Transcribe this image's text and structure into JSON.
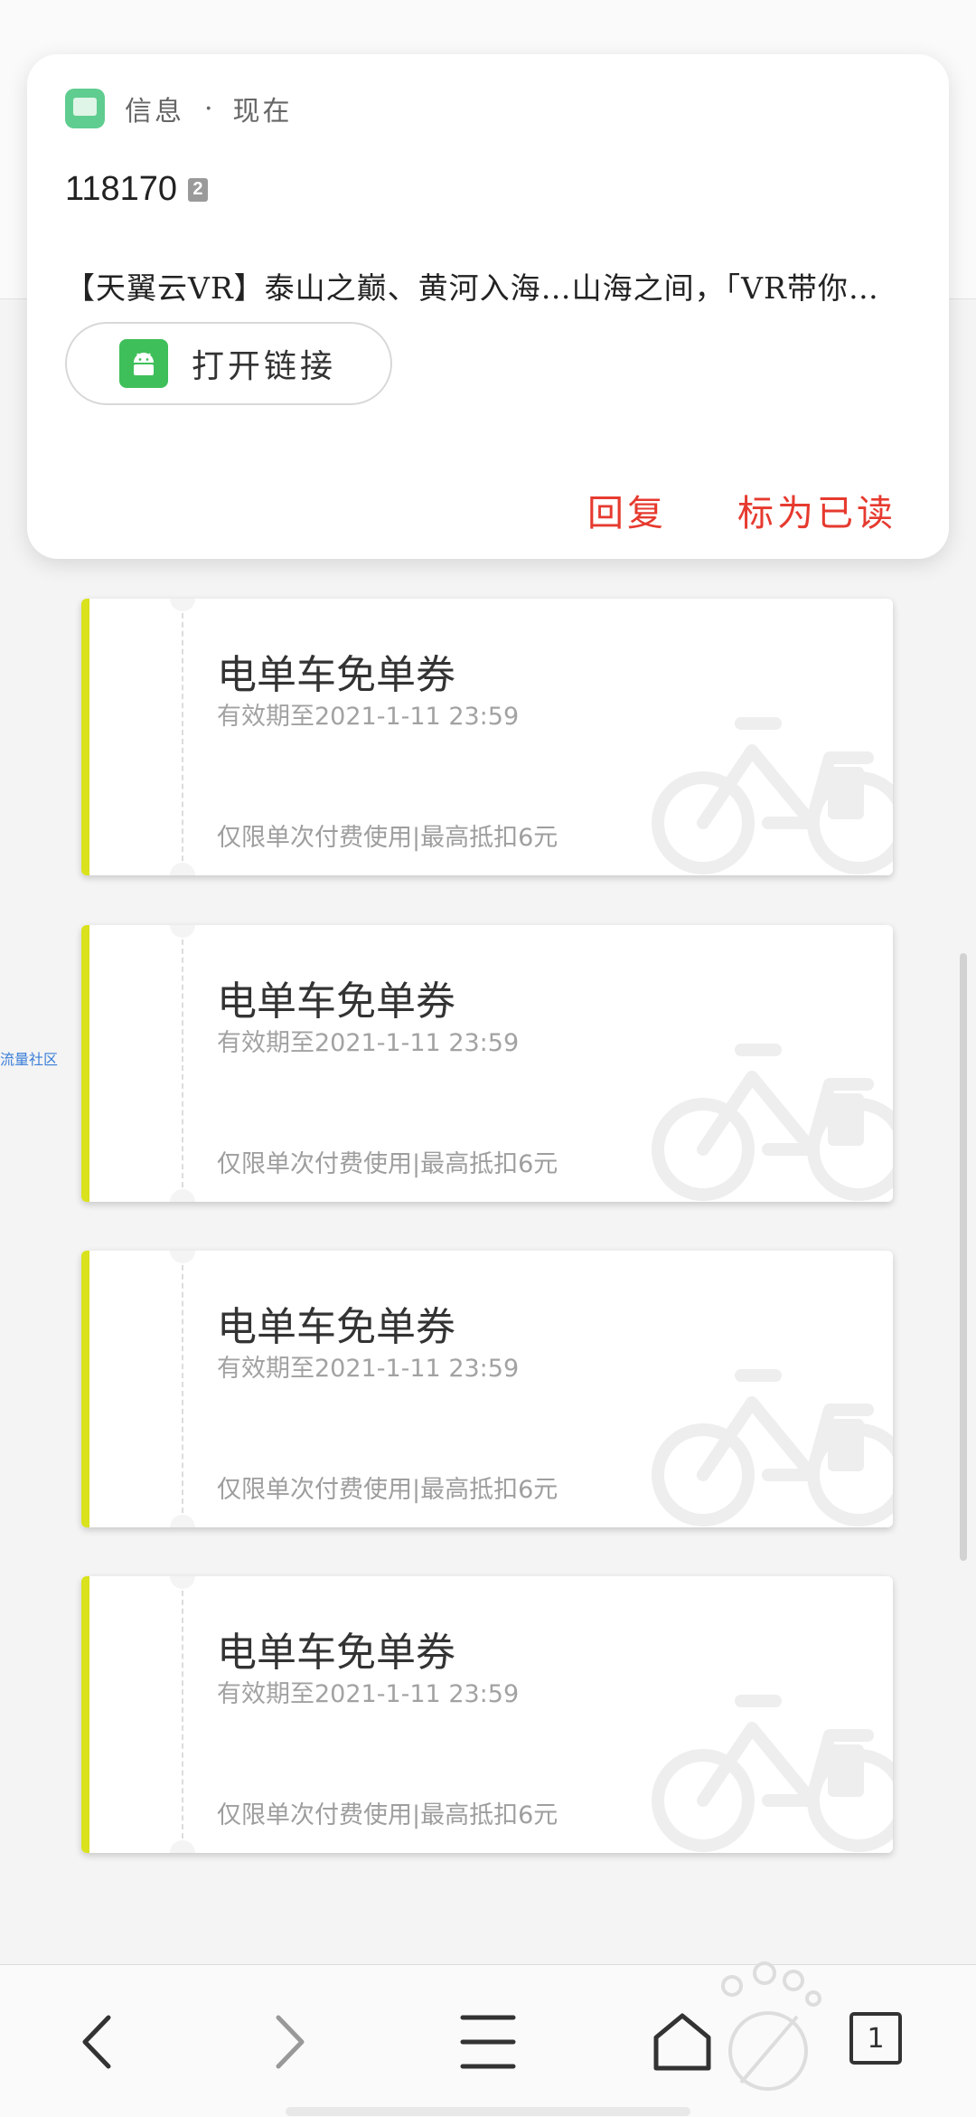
{
  "notification": {
    "app_name": "信息",
    "separator": "·",
    "time": "现在",
    "sender": "118170",
    "badge": "2",
    "message": "【天翼云VR】泰山之巅、黄河入海…山海之间，「VR带你…",
    "open_link_label": "打开链接",
    "reply_label": "回复",
    "mark_read_label": "标为已读",
    "accent_color": "#e63a2f"
  },
  "coupons": [
    {
      "title": "电单车免单券",
      "expiry": "有效期至2021-1-11 23:59",
      "terms": "仅限单次付费使用|最高抵扣6元"
    },
    {
      "title": "电单车免单券",
      "expiry": "有效期至2021-1-11 23:59",
      "terms": "仅限单次付费使用|最高抵扣6元"
    },
    {
      "title": "电单车免单券",
      "expiry": "有效期至2021-1-11 23:59",
      "terms": "仅限单次付费使用|最高抵扣6元"
    },
    {
      "title": "电单车免单券",
      "expiry": "有效期至2021-1-11 23:59",
      "terms": "仅限单次付费使用|最高抵扣6元"
    }
  ],
  "coupon_accent_color": "#d9e21c",
  "side_label": "流量社区",
  "bottom_nav": {
    "icons": [
      "back-icon",
      "forward-icon",
      "menu-icon",
      "home-icon",
      "tabs-icon"
    ],
    "tab_count": "1"
  }
}
